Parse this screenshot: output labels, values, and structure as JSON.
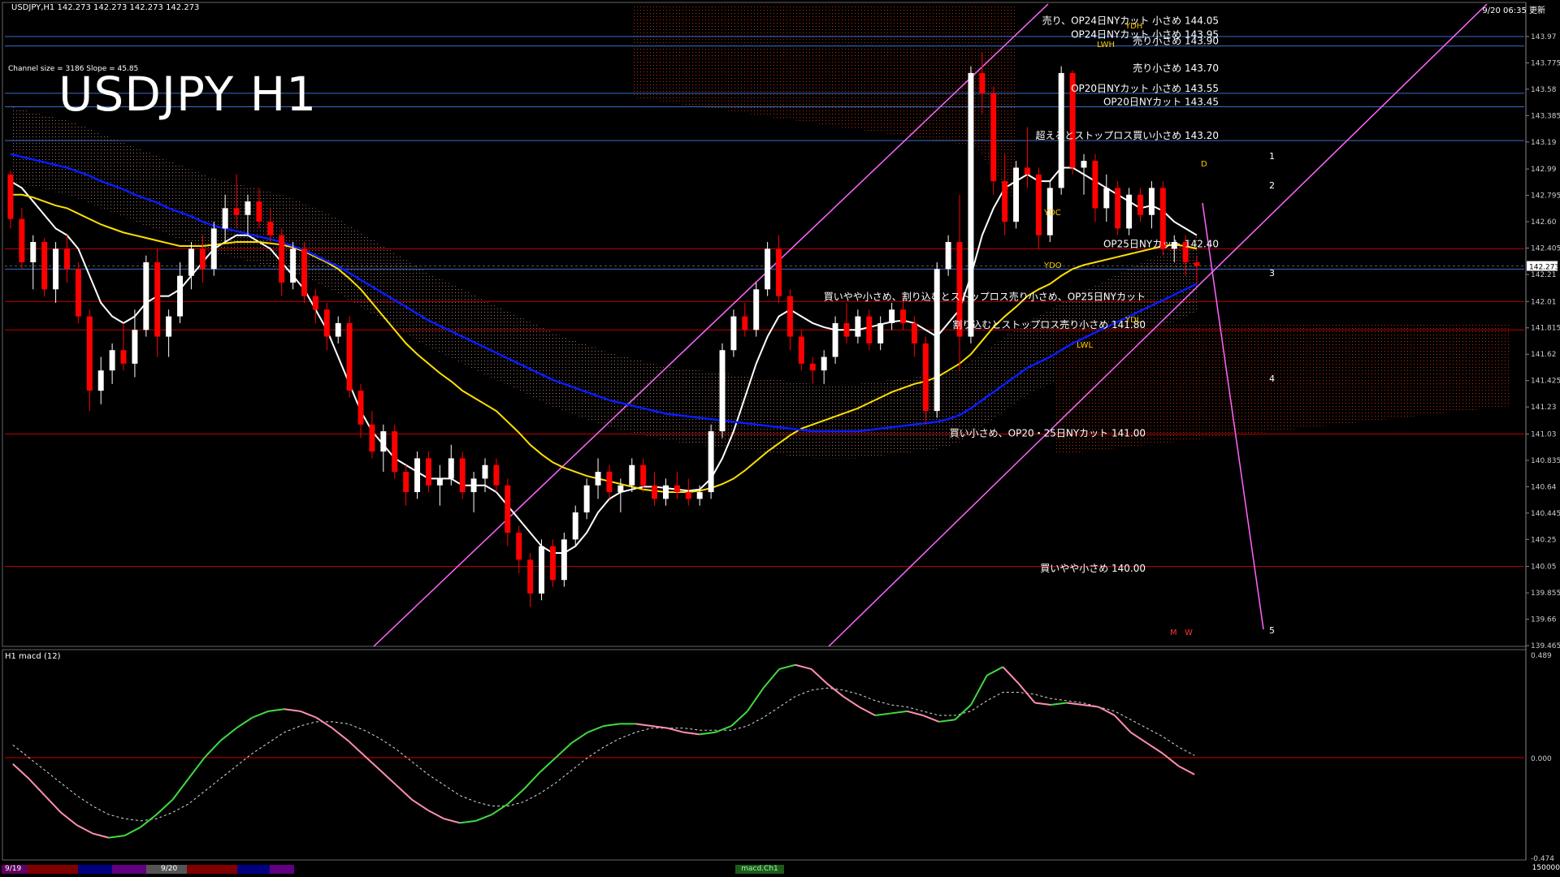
{
  "header": {
    "ohlc_text": "USDJPY,H1  142.273 142.273 142.273 142.273",
    "channel_text": "Channel size = 3186 Slope = 45.85",
    "big_title": "USDJPY H1",
    "timestamp": "9/20 06:35 更新"
  },
  "subwindow": {
    "label": "H1  macd (12)"
  },
  "bottom_bar": {
    "dates": [
      "9/19",
      "9/20"
    ],
    "macd_tab": "macd.Ch1",
    "volume": "150000"
  },
  "colors": {
    "bull": "#ffffff",
    "bear": "#ff0000",
    "ma_white": "#ffffff",
    "ma_yellow": "#ffe000",
    "ma_blue": "#0a1cff",
    "chikou": "#22cc22",
    "channel": "#ff66ff",
    "level_red": "#c00000",
    "level_blue": "#3a6cc8",
    "cloud": "#cc3300",
    "macd_main": "#3fdc3f",
    "macd_fall": "#ff8fb0"
  },
  "chart_data": {
    "type": "candlestick",
    "symbol": "USDJPY",
    "timeframe": "H1",
    "ylim": [
      139.465,
      144.21
    ],
    "y_ticks": [
      139.465,
      139.66,
      139.855,
      140.05,
      140.25,
      140.445,
      140.64,
      140.835,
      141.03,
      141.23,
      141.425,
      141.62,
      141.815,
      142.01,
      142.21,
      142.405,
      142.6,
      142.795,
      142.99,
      143.19,
      143.385,
      143.58,
      143.775,
      143.97
    ],
    "current_price": 142.273,
    "candles": [
      [
        142.95,
        142.98,
        142.55,
        142.62
      ],
      [
        142.62,
        142.7,
        142.25,
        142.3
      ],
      [
        142.3,
        142.5,
        142.1,
        142.45
      ],
      [
        142.45,
        142.48,
        142.05,
        142.1
      ],
      [
        142.1,
        142.45,
        142.0,
        142.4
      ],
      [
        142.4,
        142.5,
        142.15,
        142.25
      ],
      [
        142.25,
        142.3,
        141.85,
        141.9
      ],
      [
        141.9,
        141.95,
        141.2,
        141.35
      ],
      [
        141.35,
        141.6,
        141.25,
        141.5
      ],
      [
        141.5,
        141.7,
        141.4,
        141.65
      ],
      [
        141.65,
        141.85,
        141.5,
        141.55
      ],
      [
        141.55,
        141.95,
        141.45,
        141.8
      ],
      [
        141.8,
        142.35,
        141.75,
        142.3
      ],
      [
        142.3,
        142.4,
        141.6,
        141.75
      ],
      [
        141.75,
        141.95,
        141.6,
        141.9
      ],
      [
        141.9,
        142.3,
        141.85,
        142.2
      ],
      [
        142.2,
        142.45,
        142.1,
        142.4
      ],
      [
        142.4,
        142.5,
        142.15,
        142.25
      ],
      [
        142.25,
        142.6,
        142.2,
        142.55
      ],
      [
        142.55,
        142.8,
        142.45,
        142.7
      ],
      [
        142.7,
        142.95,
        142.55,
        142.65
      ],
      [
        142.65,
        142.8,
        142.5,
        142.75
      ],
      [
        142.75,
        142.85,
        142.55,
        142.6
      ],
      [
        142.6,
        142.7,
        142.45,
        142.5
      ],
      [
        142.5,
        142.55,
        142.05,
        142.15
      ],
      [
        142.15,
        142.45,
        142.1,
        142.4
      ],
      [
        142.4,
        142.45,
        142.0,
        142.05
      ],
      [
        142.05,
        142.1,
        141.85,
        141.95
      ],
      [
        141.95,
        142.0,
        141.65,
        141.75
      ],
      [
        141.75,
        141.9,
        141.7,
        141.85
      ],
      [
        141.85,
        141.9,
        141.3,
        141.35
      ],
      [
        141.35,
        141.4,
        141.0,
        141.1
      ],
      [
        141.1,
        141.2,
        140.85,
        140.9
      ],
      [
        140.9,
        141.1,
        140.75,
        141.05
      ],
      [
        141.05,
        141.1,
        140.7,
        140.75
      ],
      [
        140.75,
        140.8,
        140.5,
        140.6
      ],
      [
        140.6,
        140.9,
        140.55,
        140.85
      ],
      [
        140.85,
        140.9,
        140.6,
        140.65
      ],
      [
        140.65,
        140.8,
        140.5,
        140.7
      ],
      [
        140.7,
        140.95,
        140.65,
        140.85
      ],
      [
        140.85,
        140.9,
        140.55,
        140.6
      ],
      [
        140.6,
        140.75,
        140.45,
        140.7
      ],
      [
        140.7,
        140.85,
        140.6,
        140.8
      ],
      [
        140.8,
        140.85,
        140.6,
        140.65
      ],
      [
        140.65,
        140.7,
        140.2,
        140.3
      ],
      [
        140.3,
        140.35,
        140.0,
        140.1
      ],
      [
        140.1,
        140.15,
        139.75,
        139.85
      ],
      [
        139.85,
        140.25,
        139.8,
        140.2
      ],
      [
        140.2,
        140.25,
        139.9,
        139.95
      ],
      [
        139.95,
        140.3,
        139.9,
        140.25
      ],
      [
        140.25,
        140.5,
        140.2,
        140.45
      ],
      [
        140.45,
        140.7,
        140.4,
        140.65
      ],
      [
        140.65,
        140.85,
        140.55,
        140.75
      ],
      [
        140.75,
        140.8,
        140.55,
        140.6
      ],
      [
        140.6,
        140.7,
        140.45,
        140.65
      ],
      [
        140.65,
        140.85,
        140.6,
        140.8
      ],
      [
        140.8,
        140.85,
        140.6,
        140.65
      ],
      [
        140.65,
        140.75,
        140.5,
        140.55
      ],
      [
        140.55,
        140.7,
        140.5,
        140.65
      ],
      [
        140.65,
        140.75,
        140.55,
        140.6
      ],
      [
        140.6,
        140.7,
        140.5,
        140.55
      ],
      [
        140.55,
        140.65,
        140.5,
        140.6
      ],
      [
        140.6,
        141.1,
        140.55,
        141.05
      ],
      [
        141.05,
        141.7,
        141.0,
        141.65
      ],
      [
        141.65,
        141.95,
        141.6,
        141.9
      ],
      [
        141.9,
        142.0,
        141.75,
        141.8
      ],
      [
        141.8,
        142.15,
        141.75,
        142.1
      ],
      [
        142.1,
        142.45,
        142.05,
        142.4
      ],
      [
        142.4,
        142.5,
        142.0,
        142.05
      ],
      [
        142.05,
        142.1,
        141.65,
        141.75
      ],
      [
        141.75,
        141.8,
        141.5,
        141.55
      ],
      [
        141.55,
        141.6,
        141.4,
        141.5
      ],
      [
        141.5,
        141.65,
        141.4,
        141.6
      ],
      [
        141.6,
        141.9,
        141.55,
        141.85
      ],
      [
        141.85,
        142.0,
        141.7,
        141.75
      ],
      [
        141.75,
        141.95,
        141.7,
        141.9
      ],
      [
        141.9,
        141.95,
        141.65,
        141.7
      ],
      [
        141.7,
        141.9,
        141.65,
        141.85
      ],
      [
        141.85,
        142.0,
        141.8,
        141.95
      ],
      [
        141.95,
        142.05,
        141.8,
        141.85
      ],
      [
        141.85,
        141.9,
        141.6,
        141.7
      ],
      [
        141.7,
        141.75,
        141.1,
        141.2
      ],
      [
        141.2,
        142.3,
        141.15,
        142.25
      ],
      [
        142.25,
        142.5,
        142.2,
        142.45
      ],
      [
        142.45,
        142.8,
        141.5,
        141.75
      ],
      [
        141.75,
        143.75,
        141.7,
        143.7
      ],
      [
        143.7,
        143.85,
        143.4,
        143.55
      ],
      [
        143.55,
        143.6,
        142.8,
        142.9
      ],
      [
        142.9,
        143.1,
        142.5,
        142.6
      ],
      [
        142.6,
        143.05,
        142.55,
        143.0
      ],
      [
        143.0,
        143.3,
        142.85,
        142.95
      ],
      [
        142.95,
        143.0,
        142.4,
        142.5
      ],
      [
        142.5,
        142.9,
        142.45,
        142.85
      ],
      [
        142.85,
        143.75,
        142.8,
        143.7
      ],
      [
        143.7,
        143.72,
        142.95,
        143.0
      ],
      [
        143.0,
        143.1,
        142.8,
        143.05
      ],
      [
        143.05,
        143.1,
        142.6,
        142.7
      ],
      [
        142.7,
        142.95,
        142.6,
        142.85
      ],
      [
        142.85,
        142.9,
        142.5,
        142.55
      ],
      [
        142.55,
        142.85,
        142.5,
        142.8
      ],
      [
        142.8,
        142.85,
        142.6,
        142.65
      ],
      [
        142.65,
        142.9,
        142.55,
        142.85
      ],
      [
        142.85,
        142.9,
        142.35,
        142.4
      ],
      [
        142.4,
        142.5,
        142.3,
        142.45
      ],
      [
        142.45,
        142.5,
        142.2,
        142.3
      ],
      [
        142.3,
        142.35,
        142.15,
        142.273
      ]
    ],
    "indicators": {
      "ma_white": [
        142.9,
        142.85,
        142.75,
        142.65,
        142.55,
        142.5,
        142.4,
        142.2,
        142.0,
        141.9,
        141.85,
        141.9,
        142.0,
        142.05,
        142.05,
        142.1,
        142.2,
        142.3,
        142.4,
        142.45,
        142.5,
        142.5,
        142.45,
        142.4,
        142.3,
        142.2,
        142.1,
        141.95,
        141.8,
        141.6,
        141.4,
        141.2,
        141.05,
        140.95,
        140.85,
        140.8,
        140.75,
        140.7,
        140.7,
        140.7,
        140.65,
        140.65,
        140.65,
        140.6,
        140.5,
        140.4,
        140.3,
        140.2,
        140.15,
        140.15,
        140.2,
        140.3,
        140.45,
        140.55,
        140.6,
        140.62,
        140.64,
        140.64,
        140.63,
        140.62,
        140.61,
        140.62,
        140.7,
        140.85,
        141.05,
        141.3,
        141.55,
        141.75,
        141.9,
        141.95,
        141.9,
        141.85,
        141.82,
        141.8,
        141.8,
        141.8,
        141.82,
        141.84,
        141.86,
        141.87,
        141.85,
        141.8,
        141.75,
        141.85,
        141.95,
        142.2,
        142.5,
        142.7,
        142.85,
        142.9,
        142.95,
        142.9,
        142.9,
        143.0,
        143.0,
        142.95,
        142.9,
        142.85,
        142.8,
        142.75,
        142.7,
        142.72,
        142.68,
        142.6,
        142.55,
        142.5
      ],
      "ma_yellow": [
        142.8,
        142.8,
        142.78,
        142.75,
        142.72,
        142.7,
        142.66,
        142.62,
        142.58,
        142.55,
        142.52,
        142.5,
        142.48,
        142.46,
        142.44,
        142.42,
        142.42,
        142.42,
        142.43,
        142.44,
        142.45,
        142.45,
        142.45,
        142.44,
        142.43,
        142.41,
        142.38,
        142.34,
        142.3,
        142.25,
        142.18,
        142.1,
        142.0,
        141.9,
        141.8,
        141.7,
        141.62,
        141.55,
        141.48,
        141.42,
        141.35,
        141.3,
        141.25,
        141.2,
        141.12,
        141.04,
        140.95,
        140.88,
        140.82,
        140.78,
        140.75,
        140.72,
        140.7,
        140.68,
        140.66,
        140.64,
        140.62,
        140.61,
        140.6,
        140.6,
        140.6,
        140.61,
        140.63,
        140.66,
        140.7,
        140.76,
        140.83,
        140.9,
        140.96,
        141.02,
        141.07,
        141.1,
        141.13,
        141.16,
        141.19,
        141.22,
        141.26,
        141.3,
        141.34,
        141.37,
        141.4,
        141.42,
        141.45,
        141.5,
        141.55,
        141.62,
        141.72,
        141.82,
        141.9,
        141.97,
        142.05,
        142.1,
        142.14,
        142.2,
        142.25,
        142.28,
        142.3,
        142.32,
        142.34,
        142.36,
        142.38,
        142.4,
        142.42,
        142.43,
        142.42,
        142.4
      ],
      "ma_blue": [
        143.1,
        143.08,
        143.06,
        143.04,
        143.02,
        143.0,
        142.97,
        142.94,
        142.9,
        142.87,
        142.84,
        142.8,
        142.77,
        142.74,
        142.7,
        142.67,
        142.64,
        142.6,
        142.57,
        142.55,
        142.53,
        142.51,
        142.49,
        142.47,
        142.45,
        142.42,
        142.39,
        142.35,
        142.31,
        142.27,
        142.22,
        142.17,
        142.12,
        142.07,
        142.02,
        141.97,
        141.92,
        141.87,
        141.83,
        141.79,
        141.75,
        141.71,
        141.67,
        141.63,
        141.59,
        141.55,
        141.51,
        141.47,
        141.43,
        141.4,
        141.37,
        141.34,
        141.31,
        141.28,
        141.26,
        141.24,
        141.22,
        141.2,
        141.18,
        141.17,
        141.16,
        141.15,
        141.14,
        141.13,
        141.12,
        141.11,
        141.1,
        141.09,
        141.08,
        141.07,
        141.06,
        141.05,
        141.05,
        141.05,
        141.05,
        141.05,
        141.06,
        141.07,
        141.08,
        141.09,
        141.1,
        141.11,
        141.12,
        141.14,
        141.17,
        141.22,
        141.28,
        141.34,
        141.4,
        141.46,
        141.52,
        141.56,
        141.6,
        141.65,
        141.7,
        141.74,
        141.78,
        141.82,
        141.86,
        141.9,
        141.94,
        141.98,
        142.02,
        142.06,
        142.1,
        142.14
      ]
    },
    "levels_red": [
      142.4,
      142.01,
      141.8,
      141.03,
      140.05
    ],
    "levels_blue": [
      143.97,
      143.9,
      143.55,
      143.45,
      143.2,
      142.25
    ],
    "annotations": [
      {
        "text": "売り、OP24日NYカット 小さめ 144.05",
        "price": 144.05
      },
      {
        "text": "OP24日NYカット 小さめ 143.95",
        "price": 143.95
      },
      {
        "text": "売り小さめ 143.90",
        "price": 143.9
      },
      {
        "text": "売り小さめ 143.70",
        "price": 143.7
      },
      {
        "text": "OP20日NYカット 小さめ 143.55",
        "price": 143.55
      },
      {
        "text": "OP20日NYカット 143.45",
        "price": 143.45
      },
      {
        "text": "超えるとストップロス買い小さめ 143.20",
        "price": 143.2
      },
      {
        "text": "OP25日NYカット 142.40",
        "price": 142.4
      },
      {
        "text": "買いやや小さめ、割り込むとストップロス売り小さめ、OP25日NYカット",
        "price": 142.01
      },
      {
        "text": "割り込むとストップロス売り小さめ 141.80",
        "price": 141.8
      },
      {
        "text": "買い小さめ、OP20・25日NYカット 141.00",
        "price": 141.0
      },
      {
        "text": "買いやや小さめ 140.00",
        "price": 140.0
      }
    ],
    "box_labels": [
      "YDH",
      "LWH",
      "YDC",
      "YDO",
      "YDL",
      "LWL",
      "M",
      "W",
      "D"
    ],
    "wave_labels": [
      "1",
      "2",
      "3",
      "4",
      "5"
    ],
    "macd": {
      "ylim": [
        -0.474,
        0.489
      ],
      "y_ticks": [
        0.489,
        0.0,
        -0.474
      ],
      "main": [
        -0.03,
        -0.1,
        -0.18,
        -0.26,
        -0.32,
        -0.36,
        -0.38,
        -0.37,
        -0.33,
        -0.27,
        -0.2,
        -0.1,
        -0.0,
        0.08,
        0.14,
        0.19,
        0.22,
        0.23,
        0.22,
        0.19,
        0.14,
        0.08,
        0.01,
        -0.06,
        -0.13,
        -0.2,
        -0.25,
        -0.29,
        -0.31,
        -0.3,
        -0.27,
        -0.22,
        -0.15,
        -0.07,
        0.0,
        0.07,
        0.12,
        0.15,
        0.16,
        0.16,
        0.15,
        0.14,
        0.12,
        0.11,
        0.12,
        0.15,
        0.22,
        0.33,
        0.42,
        0.44,
        0.42,
        0.35,
        0.29,
        0.24,
        0.2,
        0.21,
        0.22,
        0.2,
        0.17,
        0.18,
        0.25,
        0.39,
        0.43,
        0.35,
        0.26,
        0.25,
        0.26,
        0.25,
        0.24,
        0.2,
        0.12,
        0.07,
        0.02,
        -0.04,
        -0.08
      ],
      "signal": [
        0.06,
        0.0,
        -0.06,
        -0.12,
        -0.18,
        -0.23,
        -0.27,
        -0.29,
        -0.3,
        -0.29,
        -0.26,
        -0.22,
        -0.16,
        -0.1,
        -0.04,
        0.02,
        0.07,
        0.12,
        0.15,
        0.17,
        0.17,
        0.16,
        0.13,
        0.09,
        0.04,
        -0.02,
        -0.08,
        -0.13,
        -0.18,
        -0.21,
        -0.23,
        -0.23,
        -0.21,
        -0.17,
        -0.12,
        -0.06,
        0.0,
        0.05,
        0.09,
        0.12,
        0.14,
        0.14,
        0.14,
        0.13,
        0.13,
        0.13,
        0.15,
        0.19,
        0.24,
        0.29,
        0.32,
        0.33,
        0.32,
        0.3,
        0.27,
        0.25,
        0.24,
        0.22,
        0.2,
        0.2,
        0.22,
        0.27,
        0.31,
        0.31,
        0.3,
        0.28,
        0.27,
        0.26,
        0.24,
        0.22,
        0.18,
        0.14,
        0.1,
        0.05,
        0.01
      ]
    }
  }
}
